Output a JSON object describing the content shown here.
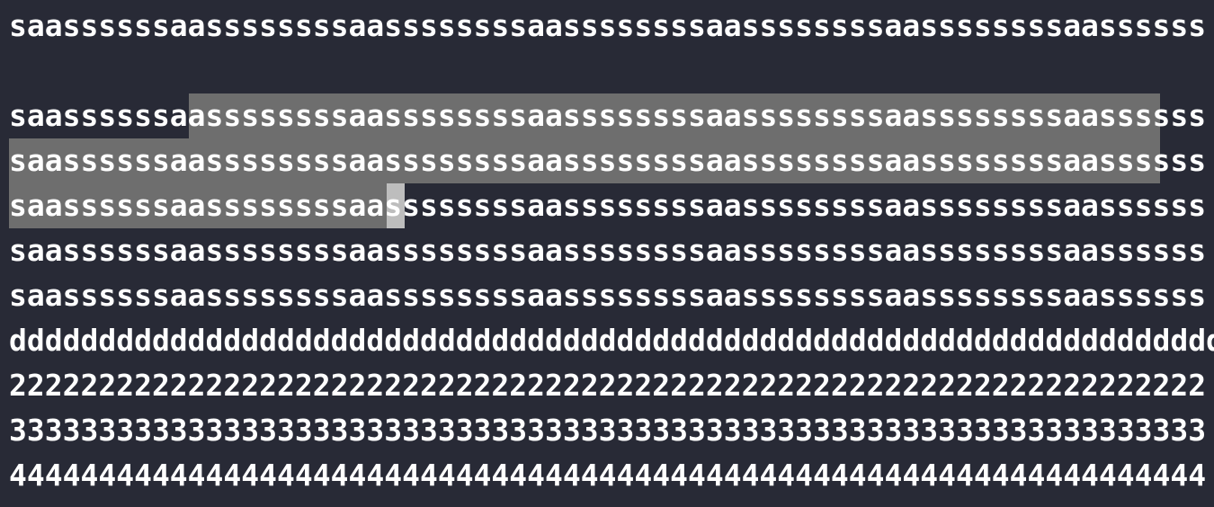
{
  "editor": {
    "lines": [
      "saassssssaassssssssaassssssssaassssssssaassssssssaassssssssaassssss",
      "",
      "saassssssaassssssssaassssssssaassssssssaassssssssaassssssssaassssss",
      "saassssssaassssssssaassssssssaassssssssaassssssssaassssssssaassssss",
      "saassssssaassssssssaassssssssaassssssssaassssssssaassssssssaassssss",
      "saassssssaassssssssaassssssssaassssssssaassssssssaassssssssaassssss",
      "saassssssaassssssssaassssssssaassssssssaassssssssaassssssssaassssss",
      "dddddddddddddddddddddddddddddddddddddddddddddddddddddddddddddddddddd",
      "2222222222222222222222222222222222222222222222222222222222222222222",
      "3333333333333333333333333333333333333333333333333333333333333333333",
      "4444444444444444444444444444444444444444444444444444444444444444444"
    ]
  },
  "colors": {
    "background": "#282a36",
    "text": "#ffffff",
    "selection": "#6e6e6e",
    "cursor": "#bdbdbd"
  }
}
